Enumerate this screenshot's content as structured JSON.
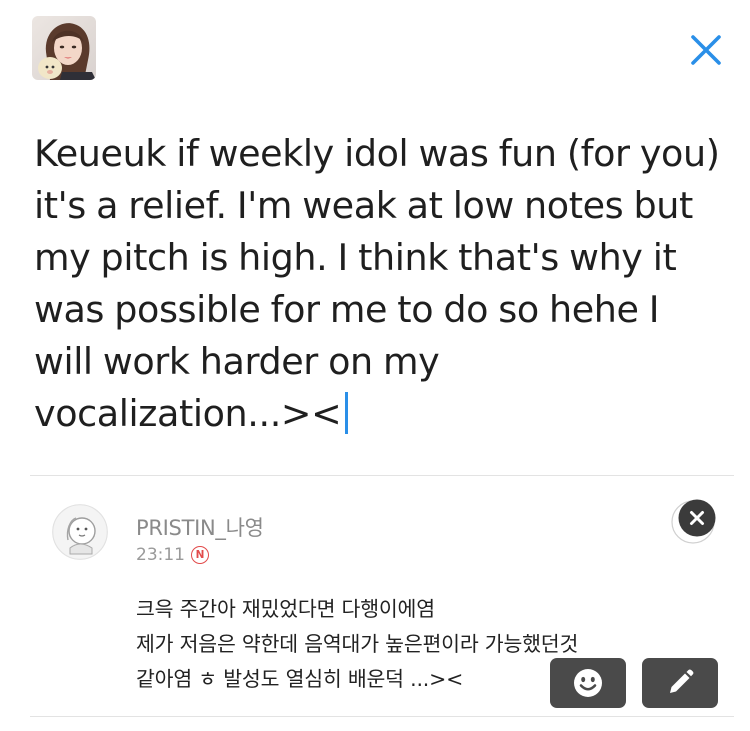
{
  "compose": {
    "text": "Keueuk if weekly idol was fun (for you) it's a relief. I'm weak at low notes but my pitch is high. I think that's why it was possible for me to do so hehe I will work harder on my vocalization...><"
  },
  "quoted_post": {
    "author": "PRISTIN_나영",
    "time": "23:11",
    "badge": "N",
    "lines": [
      "크윽 주간아 재밌었다면 다행이에염",
      "제가 저음은 약한데 음역대가 높은편이라 가능했던것",
      "같아염 ㅎ 발성도 열심히 배운덕 ...><"
    ]
  },
  "icons": {
    "close": "close-icon",
    "remove_quote": "remove-quote-icon",
    "emoji": "emoji-icon",
    "edit": "pencil-icon"
  },
  "colors": {
    "accent": "#2a8fe8",
    "tool_button": "#4a4a4a",
    "new_badge": "#e24b4b"
  }
}
